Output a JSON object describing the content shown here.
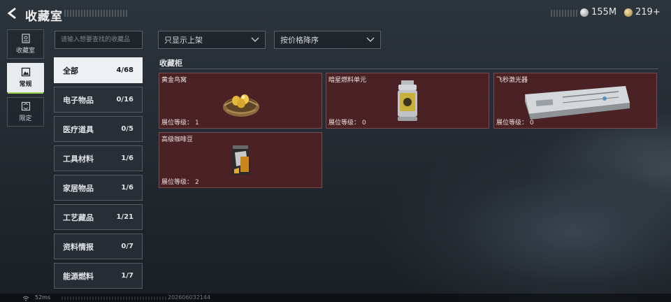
{
  "header": {
    "title": "收藏室",
    "back_icon": "back-arrow-icon"
  },
  "currency": {
    "silver": {
      "icon": "silver-coin-icon",
      "value": "155M"
    },
    "gold": {
      "icon": "gold-coin-icon",
      "value": "219+"
    }
  },
  "rail": {
    "items": [
      {
        "label": "收藏室",
        "icon": "collection-room-icon",
        "active": false
      },
      {
        "label": "常规",
        "icon": "regular-icon",
        "active": true
      },
      {
        "label": "限定",
        "icon": "limited-icon",
        "active": false
      }
    ]
  },
  "search": {
    "placeholder": "请输入想要查找的收藏品",
    "value": ""
  },
  "filters": {
    "display": {
      "label": "只显示上架"
    },
    "sort": {
      "label": "按价格降序"
    }
  },
  "categories": [
    {
      "name": "全部",
      "count": "4/68"
    },
    {
      "name": "电子物品",
      "count": "0/16"
    },
    {
      "name": "医疗道具",
      "count": "0/5"
    },
    {
      "name": "工具材料",
      "count": "1/6"
    },
    {
      "name": "家居物品",
      "count": "1/6"
    },
    {
      "name": "工艺藏品",
      "count": "1/21"
    },
    {
      "name": "资料情报",
      "count": "0/7"
    },
    {
      "name": "能源燃料",
      "count": "1/7"
    }
  ],
  "section": {
    "title": "收藏柜"
  },
  "items": [
    {
      "name": "黄金鸟窝",
      "level_label": "展位等级：",
      "level": "1"
    },
    {
      "name": "暗星燃料单元",
      "level_label": "展位等级：",
      "level": "0"
    },
    {
      "name": "飞秒激光器",
      "level_label": "展位等级：",
      "level": "0"
    },
    {
      "name": "高级咖啡豆",
      "level_label": "展位等级：",
      "level": "2"
    }
  ],
  "footer": {
    "ping": "52ms",
    "build": "202606032144"
  },
  "colors": {
    "accent": "#9ad04a",
    "card_bg": "#4a2125",
    "active_bg": "#eef0f2"
  }
}
